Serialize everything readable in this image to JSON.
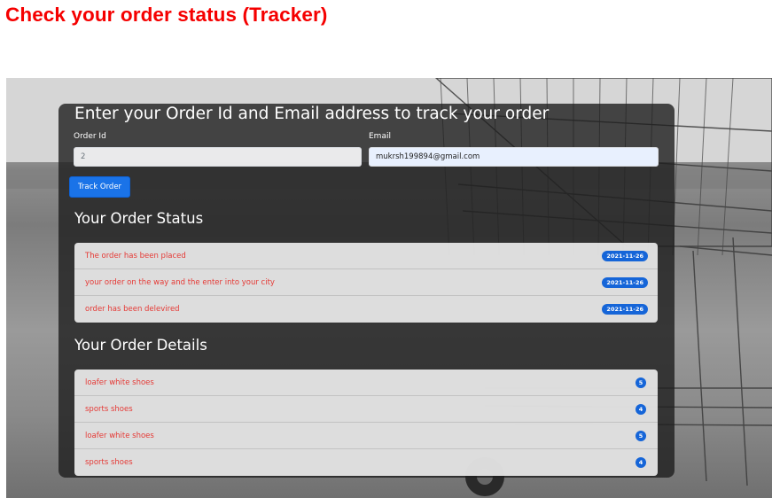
{
  "page_heading": "Check your order status (Tracker)",
  "tracker": {
    "title": "Enter your Order Id and Email address to track your order",
    "order_id_label": "Order Id",
    "order_id_value": "2",
    "email_label": "Email",
    "email_value": "mukrsh199894@gmail.com",
    "track_button": "Track Order"
  },
  "status": {
    "title": "Your Order Status",
    "items": [
      {
        "text": "The order has been placed",
        "date": "2021-11-26"
      },
      {
        "text": "your order on the way and the enter into your city",
        "date": "2021-11-26"
      },
      {
        "text": "order has been delevired",
        "date": "2021-11-26"
      }
    ]
  },
  "details": {
    "title": "Your Order Details",
    "items": [
      {
        "name": "loafer white shoes",
        "qty": "5"
      },
      {
        "name": "sports shoes",
        "qty": "4"
      },
      {
        "name": "loafer white shoes",
        "qty": "5"
      },
      {
        "name": "sports shoes",
        "qty": "4"
      }
    ]
  },
  "colors": {
    "heading": "#f50000",
    "item_text": "#e53935",
    "badge": "#1565d8",
    "button": "#1a73e8"
  },
  "background": "shopping-cart-photo"
}
